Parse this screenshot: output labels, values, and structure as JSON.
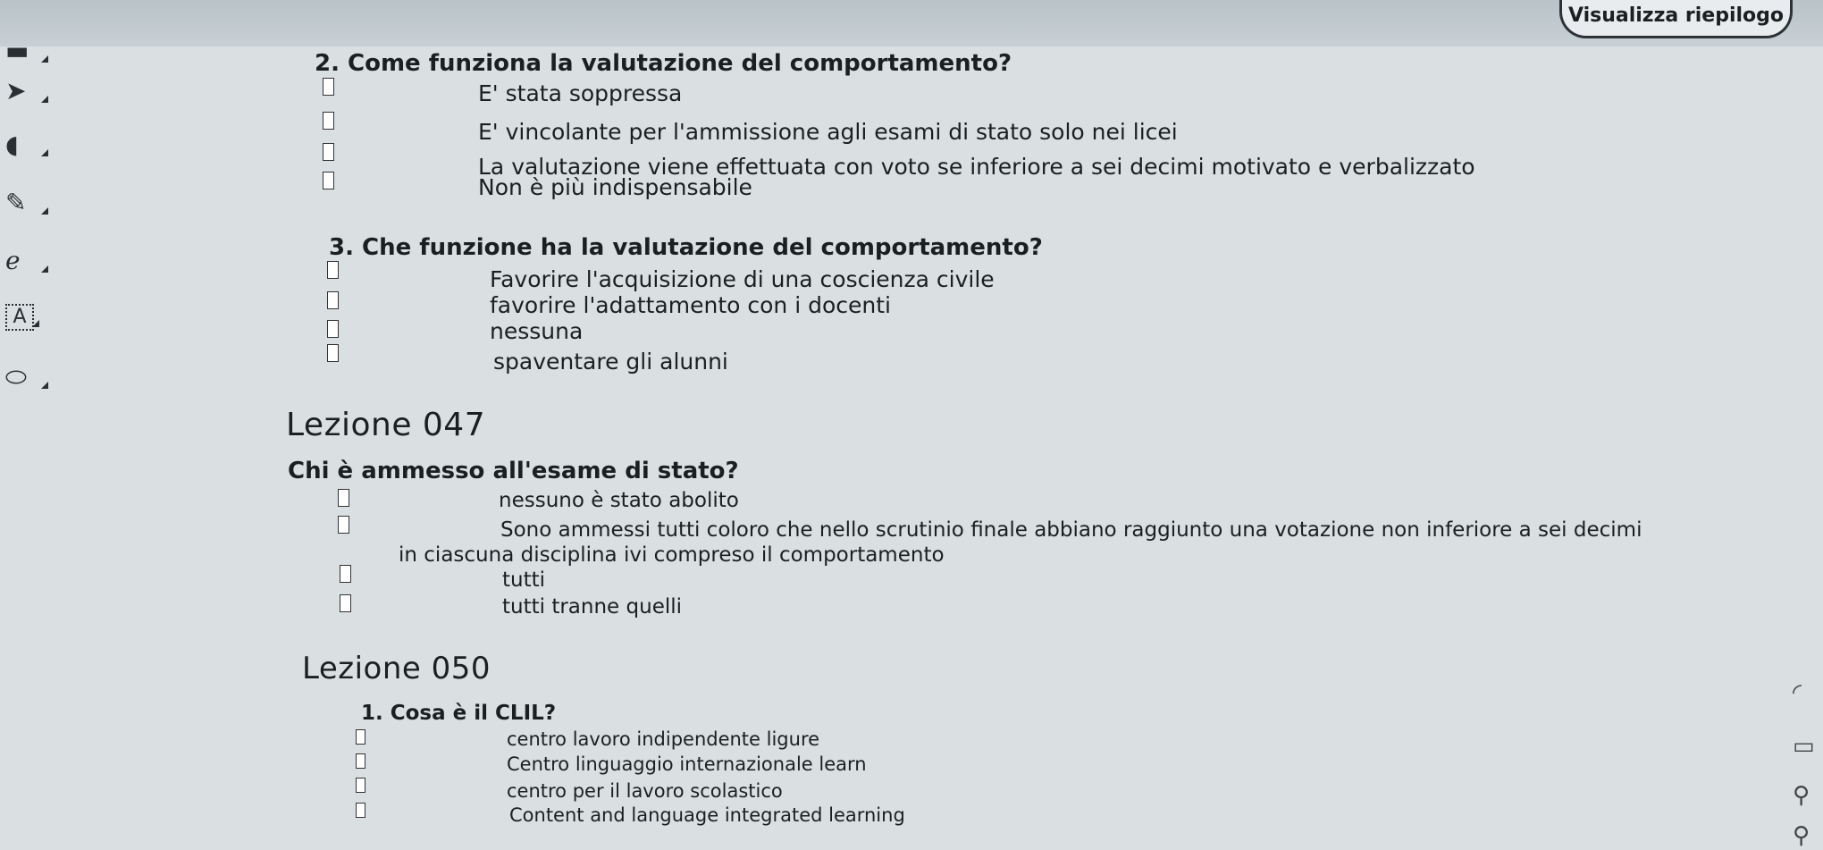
{
  "header": {
    "summary_button": "Visualizza riepilogo"
  },
  "toolbar": {
    "icons": [
      "collapse-icon",
      "pointer-icon",
      "highlighter-icon",
      "pen-icon",
      "eraser-icon",
      "text-icon",
      "shapes-icon"
    ]
  },
  "section1": {
    "q2": {
      "title": "2.   Come funziona la valutazione del comportamento?",
      "options": [
        "E' stata soppressa",
        "E' vincolante per l'ammissione agli esami di stato solo nei licei",
        "La valutazione viene effettuata con voto se inferiore a sei decimi motivato e verbalizzato",
        "Non è più indispensabile"
      ]
    },
    "q3": {
      "title": "3.   Che funzione ha la valutazione del comportamento?",
      "options": [
        "Favorire l'acquisizione di una coscienza civile",
        "favorire l'adattamento con i docenti",
        "nessuna",
        "spaventare gli alunni"
      ]
    }
  },
  "lesson047": {
    "heading": "Lezione 047",
    "q": {
      "title": "Chi è ammesso all'esame di stato?",
      "options": [
        "nessuno è stato abolito",
        "Sono ammessi tutti coloro che nello scrutinio finale abbiano raggiunto una votazione non inferiore a sei decimi",
        "tutti",
        "tutti tranne quelli"
      ],
      "continuation": "in ciascuna disciplina ivi compreso il comportamento"
    }
  },
  "lesson050": {
    "heading": "Lezione 050",
    "q1": {
      "title": "1.   Cosa è il CLIL?",
      "options": [
        "centro lavoro indipendente ligure",
        "Centro linguaggio internazionale learn",
        "centro per il lavoro scolastico",
        "Content and language integrated learning"
      ]
    }
  }
}
